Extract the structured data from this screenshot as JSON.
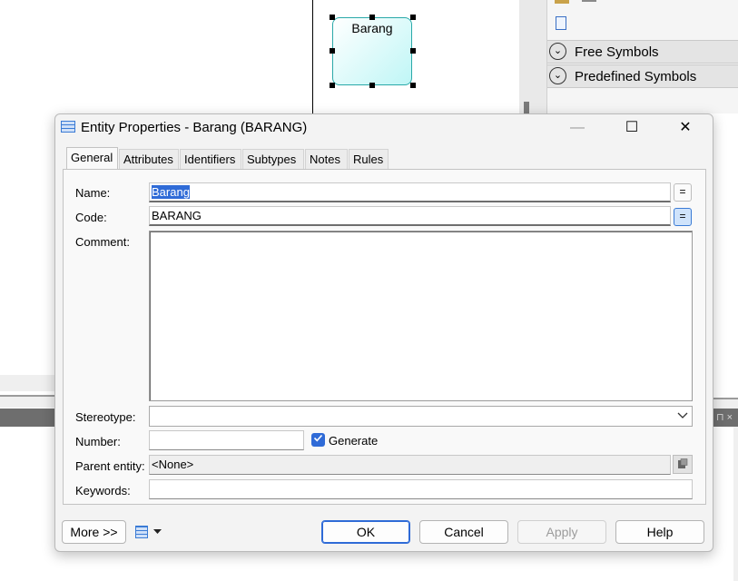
{
  "diagram": {
    "entity_name": "Barang"
  },
  "toolbox": {
    "groups": [
      {
        "label": "Free Symbols"
      },
      {
        "label": "Predefined Symbols"
      }
    ],
    "side_glyph": "⊓ ×"
  },
  "dialog": {
    "title": "Entity Properties - Barang (BARANG)",
    "window_buttons": {
      "minimize": "—",
      "maximize": "☐",
      "close": "✕"
    },
    "tabs": [
      {
        "label": "General",
        "active": true
      },
      {
        "label": "Attributes"
      },
      {
        "label": "Identifiers"
      },
      {
        "label": "Subtypes"
      },
      {
        "label": "Notes"
      },
      {
        "label": "Rules"
      }
    ],
    "fields": {
      "name_label": "Name:",
      "name_value": "Barang",
      "code_label": "Code:",
      "code_value": "BARANG",
      "comment_label": "Comment:",
      "comment_value": "",
      "stereotype_label": "Stereotype:",
      "stereotype_value": "",
      "number_label": "Number:",
      "number_value": "",
      "generate_label": "Generate",
      "generate_checked": true,
      "parent_label": "Parent entity:",
      "parent_value": "<None>",
      "keywords_label": "Keywords:",
      "keywords_value": "",
      "equals_glyph": "="
    },
    "footer": {
      "more": "More >>",
      "ok": "OK",
      "cancel": "Cancel",
      "apply": "Apply",
      "help": "Help"
    }
  },
  "colors": {
    "accent": "#2f6bd7",
    "entity_fill": "#bff6f6",
    "entity_border": "#2aa9a9"
  }
}
